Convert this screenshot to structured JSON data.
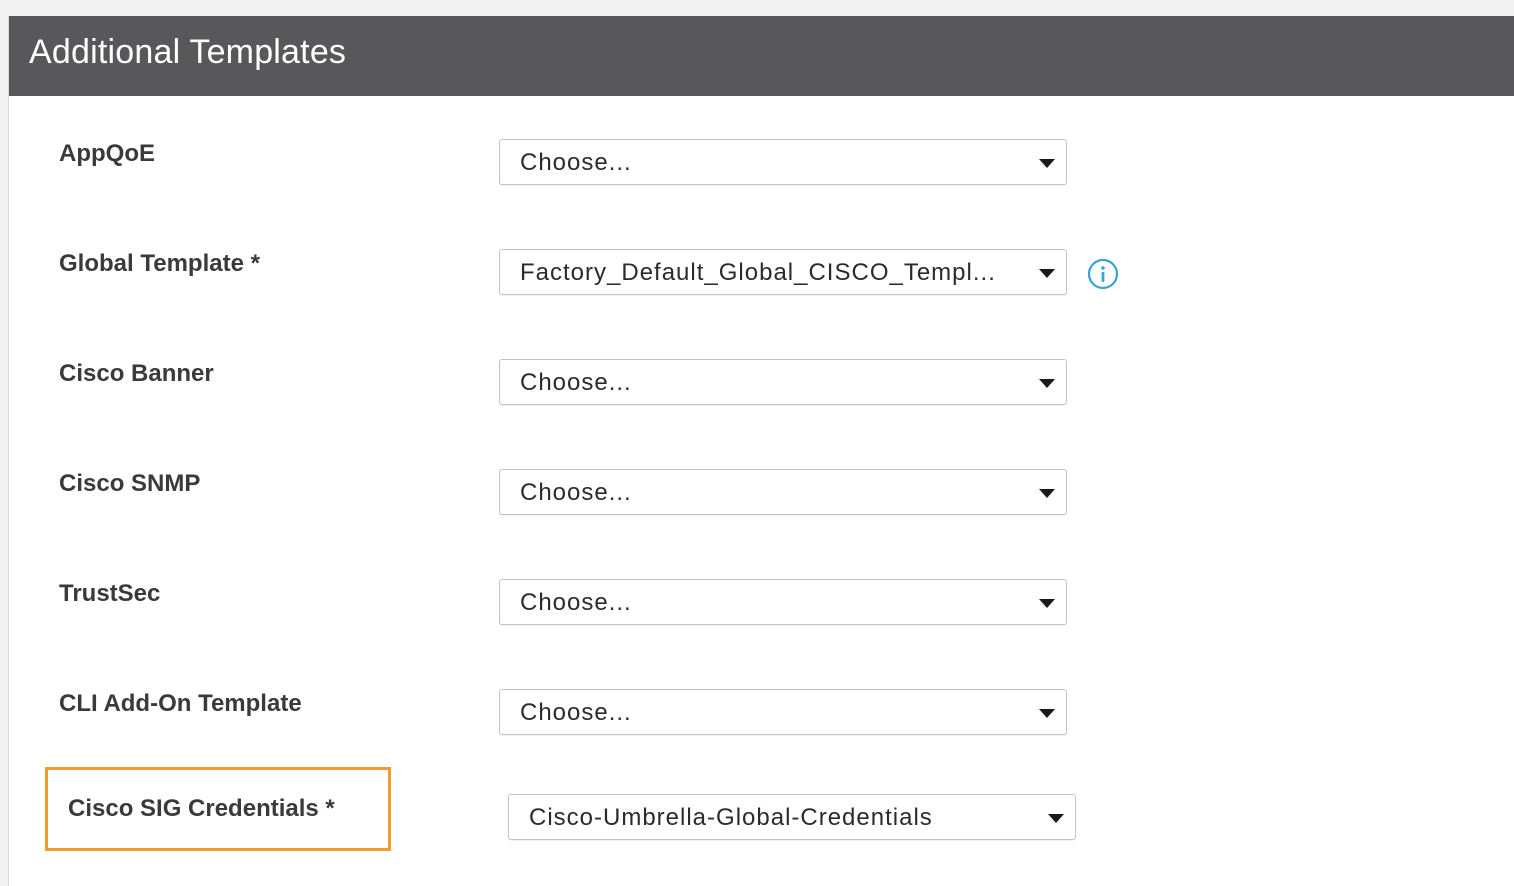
{
  "panel": {
    "title": "Additional Templates"
  },
  "fields": [
    {
      "label": "AppQoE",
      "value": "Choose..."
    },
    {
      "label": "Global Template *",
      "value": "Factory_Default_Global_CISCO_Templ..."
    },
    {
      "label": "Cisco Banner",
      "value": "Choose..."
    },
    {
      "label": "Cisco SNMP",
      "value": "Choose..."
    },
    {
      "label": "TrustSec",
      "value": "Choose..."
    },
    {
      "label": "CLI Add-On Template",
      "value": "Choose..."
    },
    {
      "label": "Cisco SIG Credentials *",
      "value": "Cisco-Umbrella-Global-Credentials"
    }
  ],
  "icons": {
    "info": "info-icon",
    "dropdown": "caret-down-icon"
  },
  "colors": {
    "header_bg": "#58585a",
    "highlight": "#f29b33",
    "info_icon": "#3aa3d6"
  }
}
